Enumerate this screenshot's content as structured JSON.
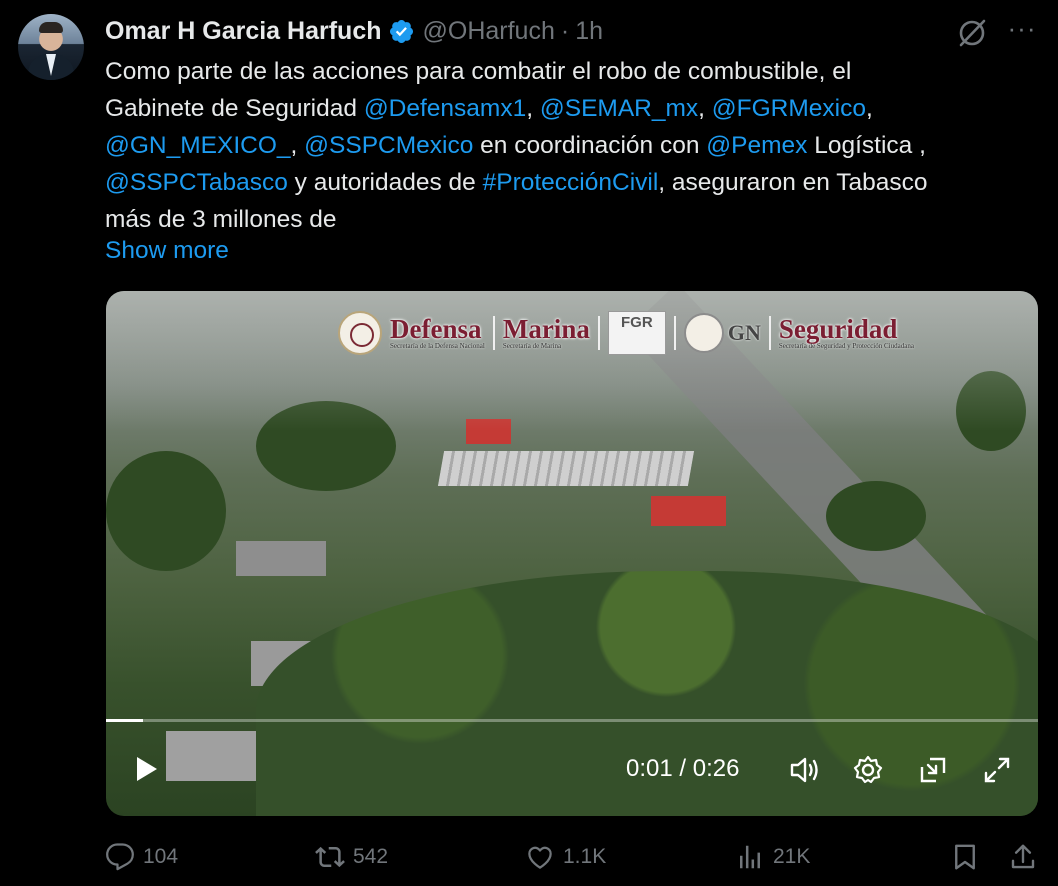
{
  "tweet": {
    "author_name": "Omar H Garcia Harfuch",
    "handle": "@OHarfuch",
    "separator": "·",
    "time": "1h",
    "more_label": "···",
    "text": {
      "t1": "Como parte de las acciones para combatir el robo de combustible, el",
      "t2": "Gabinete de Seguridad ",
      "m1": "@Defensamx1",
      "c1": ", ",
      "m2": "@SEMAR_mx",
      "c2": ", ",
      "m3": "@FGRMexico",
      "c3": ",",
      "m4": "@GN_MEXICO_",
      "c4": ", ",
      "m5": "@SSPCMexico",
      "t3": " en coordinación con ",
      "m6": "@Pemex",
      "t4": " Logística ,",
      "m7": "@SSPCTabasco",
      "t5": " y autoridades de ",
      "h1": "#ProtecciónCivil",
      "t6": ", aseguraron en Tabasco",
      "t7": "más de 3 millones de"
    },
    "show_more": "Show more"
  },
  "video": {
    "logos": {
      "defensa": "Defensa",
      "defensa_sub": "Secretaría de la Defensa Nacional",
      "marina": "Marina",
      "marina_sub": "Secretaría de Marina",
      "fgr": "FGR",
      "gn": "GN",
      "seguridad": "Seguridad",
      "seguridad_sub": "Secretaría de Seguridad y Protección Ciudadana"
    },
    "time_display": "0:01 / 0:26",
    "progress_fraction": 0.04
  },
  "actions": {
    "replies": "104",
    "reposts": "542",
    "likes": "1.1K",
    "views": "21K"
  },
  "colors": {
    "accent": "#1d9bf0",
    "muted": "#71767b",
    "text": "#e7e9ea",
    "background": "#000000"
  }
}
